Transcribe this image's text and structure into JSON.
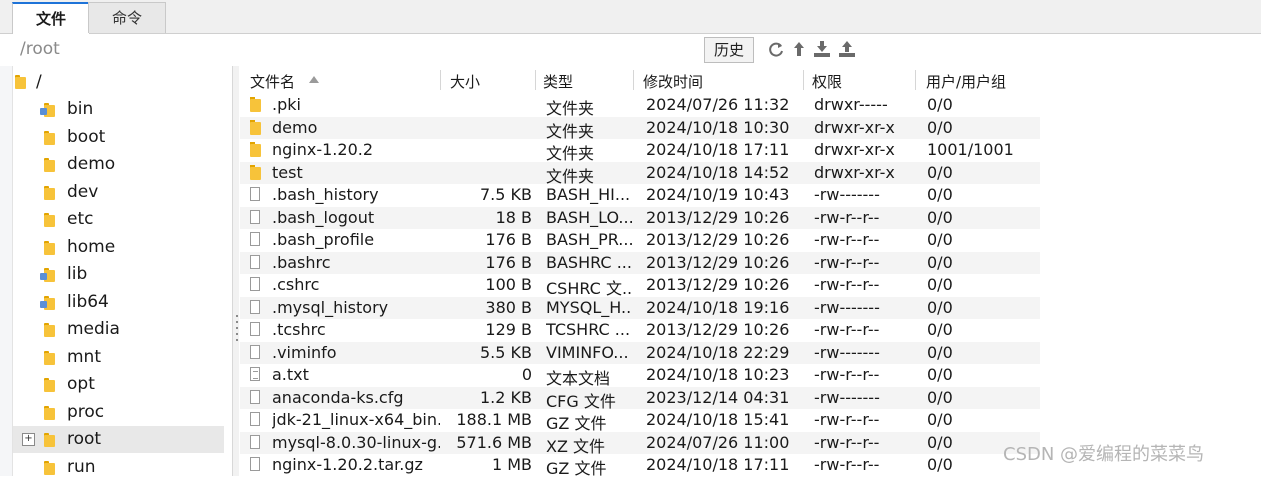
{
  "tabs": [
    {
      "label": "文件",
      "active": true
    },
    {
      "label": "命令",
      "active": false
    }
  ],
  "path": "/root",
  "history_button": "历史",
  "toolbar_icons": [
    "refresh-icon",
    "up-icon",
    "download-icon",
    "upload-icon"
  ],
  "tree": {
    "root_label": "/",
    "items": [
      {
        "label": "bin",
        "link": true
      },
      {
        "label": "boot",
        "link": false
      },
      {
        "label": "demo",
        "link": false
      },
      {
        "label": "dev",
        "link": false
      },
      {
        "label": "etc",
        "link": false
      },
      {
        "label": "home",
        "link": false
      },
      {
        "label": "lib",
        "link": true
      },
      {
        "label": "lib64",
        "link": true
      },
      {
        "label": "media",
        "link": false
      },
      {
        "label": "mnt",
        "link": false
      },
      {
        "label": "opt",
        "link": false
      },
      {
        "label": "proc",
        "link": false
      },
      {
        "label": "root",
        "link": false,
        "selected": true
      },
      {
        "label": "run",
        "link": false
      }
    ]
  },
  "columns": [
    "文件名",
    "大小",
    "类型",
    "修改时间",
    "权限",
    "用户/用户组"
  ],
  "files": [
    {
      "name": ".pki",
      "size": "",
      "type": "文件夹",
      "mtime": "2024/07/26 11:32",
      "perm": "drwxr-----",
      "owner": "0/0",
      "icon": "dir"
    },
    {
      "name": "demo",
      "size": "",
      "type": "文件夹",
      "mtime": "2024/10/18 10:30",
      "perm": "drwxr-xr-x",
      "owner": "0/0",
      "icon": "dir"
    },
    {
      "name": "nginx-1.20.2",
      "size": "",
      "type": "文件夹",
      "mtime": "2024/10/18 17:11",
      "perm": "drwxr-xr-x",
      "owner": "1001/1001",
      "icon": "dir"
    },
    {
      "name": "test",
      "size": "",
      "type": "文件夹",
      "mtime": "2024/10/18 14:52",
      "perm": "drwxr-xr-x",
      "owner": "0/0",
      "icon": "dir"
    },
    {
      "name": ".bash_history",
      "size": "7.5 KB",
      "type": "BASH_HI...",
      "mtime": "2024/10/19 10:43",
      "perm": "-rw-------",
      "owner": "0/0",
      "icon": "file"
    },
    {
      "name": ".bash_logout",
      "size": "18 B",
      "type": "BASH_LO...",
      "mtime": "2013/12/29 10:26",
      "perm": "-rw-r--r--",
      "owner": "0/0",
      "icon": "file"
    },
    {
      "name": ".bash_profile",
      "size": "176 B",
      "type": "BASH_PR...",
      "mtime": "2013/12/29 10:26",
      "perm": "-rw-r--r--",
      "owner": "0/0",
      "icon": "file"
    },
    {
      "name": ".bashrc",
      "size": "176 B",
      "type": "BASHRC ...",
      "mtime": "2013/12/29 10:26",
      "perm": "-rw-r--r--",
      "owner": "0/0",
      "icon": "file"
    },
    {
      "name": ".cshrc",
      "size": "100 B",
      "type": "CSHRC 文...",
      "mtime": "2013/12/29 10:26",
      "perm": "-rw-r--r--",
      "owner": "0/0",
      "icon": "file"
    },
    {
      "name": ".mysql_history",
      "size": "380 B",
      "type": "MYSQL_H...",
      "mtime": "2024/10/18 19:16",
      "perm": "-rw-------",
      "owner": "0/0",
      "icon": "file"
    },
    {
      "name": ".tcshrc",
      "size": "129 B",
      "type": "TCSHRC ...",
      "mtime": "2013/12/29 10:26",
      "perm": "-rw-r--r--",
      "owner": "0/0",
      "icon": "file"
    },
    {
      "name": ".viminfo",
      "size": "5.5 KB",
      "type": "VIMINFO...",
      "mtime": "2024/10/18 22:29",
      "perm": "-rw-------",
      "owner": "0/0",
      "icon": "file"
    },
    {
      "name": "a.txt",
      "size": "0",
      "type": "文本文档",
      "mtime": "2024/10/18 10:23",
      "perm": "-rw-r--r--",
      "owner": "0/0",
      "icon": "txt"
    },
    {
      "name": "anaconda-ks.cfg",
      "size": "1.2 KB",
      "type": "CFG 文件",
      "mtime": "2023/12/14 04:31",
      "perm": "-rw-------",
      "owner": "0/0",
      "icon": "file"
    },
    {
      "name": "jdk-21_linux-x64_bin...",
      "size": "188.1 MB",
      "type": "GZ 文件",
      "mtime": "2024/10/18 15:41",
      "perm": "-rw-r--r--",
      "owner": "0/0",
      "icon": "file"
    },
    {
      "name": "mysql-8.0.30-linux-g...",
      "size": "571.6 MB",
      "type": "XZ 文件",
      "mtime": "2024/07/26 11:00",
      "perm": "-rw-r--r--",
      "owner": "0/0",
      "icon": "file"
    },
    {
      "name": "nginx-1.20.2.tar.gz",
      "size": "1 MB",
      "type": "GZ 文件",
      "mtime": "2024/10/18 17:11",
      "perm": "-rw-r--r--",
      "owner": "0/0",
      "icon": "file"
    }
  ],
  "watermark": "CSDN @爱编程的菜菜鸟"
}
